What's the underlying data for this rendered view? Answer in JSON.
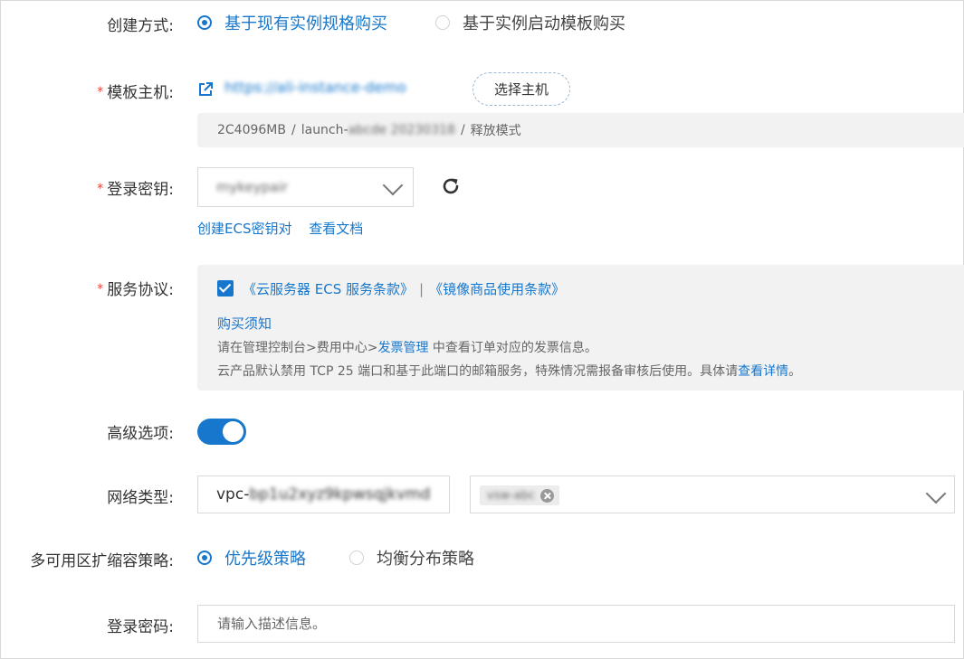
{
  "create_method": {
    "label": "创建方式:",
    "options": [
      "基于现有实例规格购买",
      "基于实例启动模板购买"
    ],
    "selected_index": 0
  },
  "template_host": {
    "label": "模板主机:",
    "required_mark": "*",
    "host_link": "https://ali-instance-demo",
    "select_button": "选择主机",
    "spec": {
      "size": "2C4096MB",
      "template_prefix": "launch-",
      "template_hidden": "abcde 20230318",
      "mode": "释放模式",
      "separator": "/"
    }
  },
  "login_key": {
    "label": "登录密钥:",
    "required_mark": "*",
    "value": "mykeypair",
    "links": [
      "创建ECS密钥对",
      "查看文档"
    ]
  },
  "agreement": {
    "label": "服务协议:",
    "required_mark": "*",
    "checked": true,
    "term1": "《云服务器 ECS 服务条款》",
    "divider": "|",
    "term2": "《镜像商品使用条款》",
    "notice_title": "购买须知",
    "line1_pre": "请在管理控制台>费用中心>",
    "line1_link": "发票管理",
    "line1_post": " 中查看订单对应的发票信息。",
    "line2_pre": "云产品默认禁用 TCP 25 端口和基于此端口的邮箱服务，特殊情况需报备审核后使用。具体请",
    "line2_link": "查看详情",
    "line2_post": "。"
  },
  "advanced": {
    "label": "高级选项:",
    "enabled": true
  },
  "network": {
    "label": "网络类型:",
    "vpc_prefix": "vpc-",
    "vpc_hidden": "bp1u2xyz9kpwsqjkvmd",
    "vswitch_tag": "vsw-abc"
  },
  "scaling_policy": {
    "label": "多可用区扩缩容策略:",
    "options": [
      "优先级策略",
      "均衡分布策略"
    ],
    "selected_index": 0
  },
  "login_password": {
    "label": "登录密码:",
    "placeholder": "请输入描述信息。"
  },
  "colors": {
    "accent": "#1677cc",
    "required": "#f04134",
    "panel_bg": "#f2f2f2"
  }
}
